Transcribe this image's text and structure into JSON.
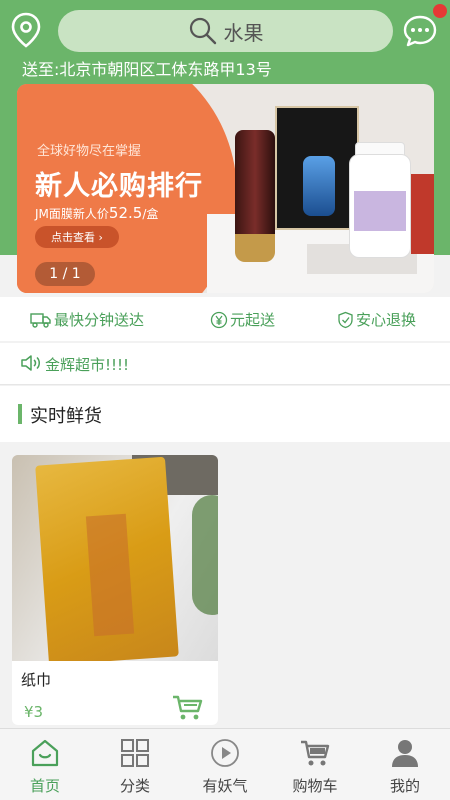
{
  "header": {
    "search_placeholder": "水果",
    "address": "送至:北京市朝阳区工体东路甲13号"
  },
  "banner": {
    "subtitle": "全球好物尽在掌握",
    "title": "新人必购排行",
    "price_text": "JM面膜新人价",
    "price_value": "52.5",
    "price_unit": "/盒",
    "button": "点击查看",
    "indicator": "1 / 1"
  },
  "features": [
    {
      "icon": "truck-icon",
      "label": "最快分钟送达"
    },
    {
      "icon": "yen-circle-icon",
      "label": "元起送"
    },
    {
      "icon": "shield-check-icon",
      "label": "安心退换"
    }
  ],
  "notice": {
    "text": "金辉超市!!!!"
  },
  "section": {
    "title": "实时鲜货"
  },
  "products": [
    {
      "name": "纸巾",
      "price": "¥3"
    }
  ],
  "nav": [
    {
      "label": "首页",
      "icon": "home-icon",
      "active": true
    },
    {
      "label": "分类",
      "icon": "grid-icon",
      "active": false
    },
    {
      "label": "有妖气",
      "icon": "play-circle-icon",
      "active": false
    },
    {
      "label": "购物车",
      "icon": "cart-icon",
      "active": false
    },
    {
      "label": "我的",
      "icon": "user-icon",
      "active": false
    }
  ],
  "colors": {
    "brand": "#6bb56a",
    "accent_text": "#4aa05a",
    "badge": "#e53935"
  }
}
